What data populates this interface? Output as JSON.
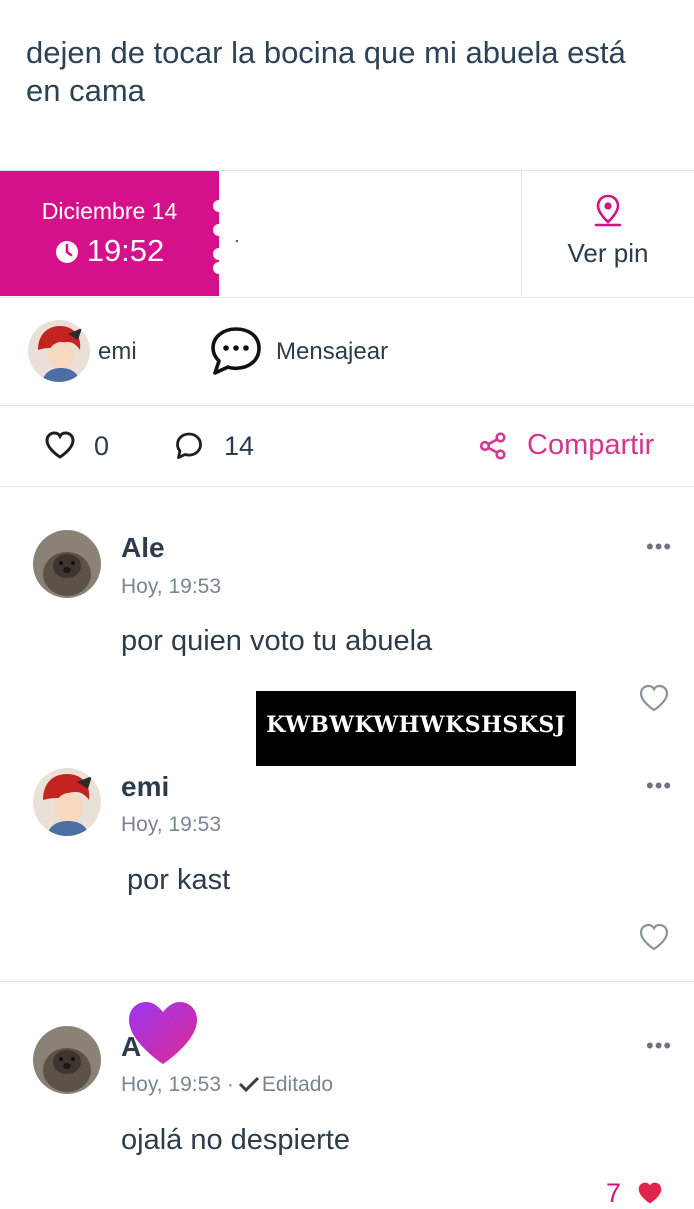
{
  "post": {
    "title": "dejen de tocar la bocina que mi abuela está en cama",
    "date": "Diciembre 14",
    "time": "19:52",
    "pin_label": "Ver pin",
    "author_name": "emi",
    "message_label": "Mensajear",
    "likes": "0",
    "comments": "14",
    "share_label": "Compartir"
  },
  "overlay_text": "KWBWKWHWKSHSKSJ",
  "comments": [
    {
      "name": "Ale",
      "time": "Hoy, 19:53",
      "text": "por quien voto tu abuela",
      "menu": "•••"
    },
    {
      "name": "emi",
      "time": "Hoy, 19:53",
      "text": "por kast",
      "menu": "•••"
    },
    {
      "name": "A",
      "time": "Hoy, 19:53",
      "edited": "Editado",
      "text": "ojalá no despierte",
      "menu": "•••",
      "likes": "7"
    }
  ],
  "colors": {
    "accent": "#d4118a",
    "share": "#d4388e",
    "text": "#2d3b4a",
    "meta": "#7a8591"
  }
}
